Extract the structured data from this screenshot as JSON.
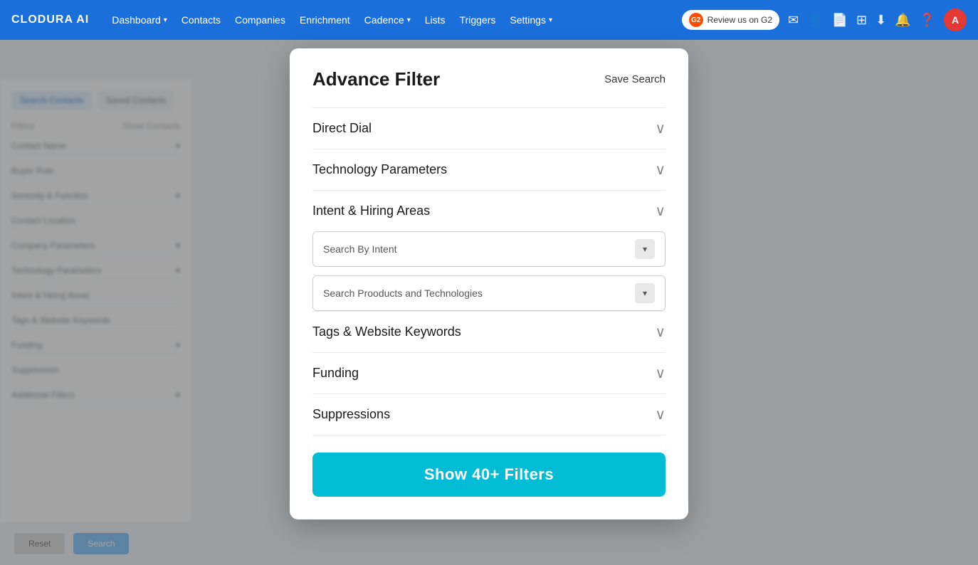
{
  "navbar": {
    "logo": "CLODURA AI",
    "items": [
      {
        "label": "Dashboard",
        "hasDropdown": true
      },
      {
        "label": "Contacts",
        "hasDropdown": false
      },
      {
        "label": "Companies",
        "hasDropdown": false
      },
      {
        "label": "Enrichment",
        "hasDropdown": false
      },
      {
        "label": "Cadence",
        "hasDropdown": true
      },
      {
        "label": "Lists",
        "hasDropdown": false
      },
      {
        "label": "Triggers",
        "hasDropdown": false
      },
      {
        "label": "Settings",
        "hasDropdown": true
      }
    ],
    "g2_label": "Review us on G2",
    "avatar_letter": "A"
  },
  "sidebar": {
    "tab1": "Search Contacts",
    "tab2": "Saved Contacts",
    "filter_label": "Filters",
    "show_count": "Show Contacts",
    "sections": [
      "Contact Name",
      "Buyer Role",
      "Seniority & Function",
      "Contact Location",
      "Company Parameters",
      "Technology Parameters",
      "Intent & Hiring Areas",
      "Tags & Website Keywords",
      "Funding",
      "Suppression",
      "Additional Filters"
    ]
  },
  "modal": {
    "title": "Advance Filter",
    "save_search_label": "Save Search",
    "filters": [
      {
        "label": "Direct Dial",
        "expanded": false
      },
      {
        "label": "Technology Parameters",
        "expanded": false
      },
      {
        "label": "Intent & Hiring Areas",
        "expanded": true
      },
      {
        "label": "Tags & Website Keywords",
        "expanded": false
      },
      {
        "label": "Funding",
        "expanded": false
      },
      {
        "label": "Suppressions",
        "expanded": false
      }
    ],
    "intent_dropdowns": [
      {
        "placeholder": "Search By Intent"
      },
      {
        "placeholder": "Search Prooducts and Technologies"
      }
    ],
    "show_filters_button": "Show 40+ Filters"
  },
  "bottom": {
    "btn1": "Reset",
    "btn2": "Search"
  }
}
